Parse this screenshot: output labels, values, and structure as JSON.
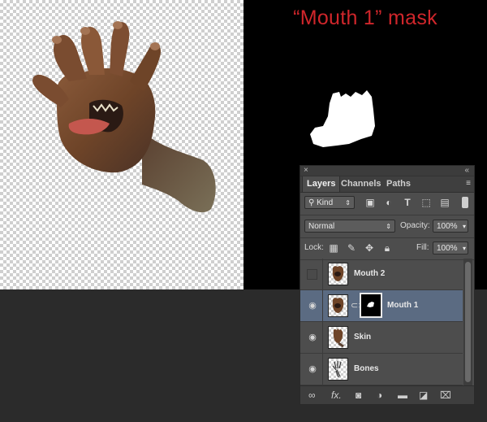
{
  "canvas": {
    "mask_label": "“Mouth 1” mask"
  },
  "panel": {
    "collapse_glyph": "«",
    "close_glyph": "×",
    "menu_glyph": "≡",
    "tabs": [
      {
        "label": "Layers",
        "active": true
      },
      {
        "label": "Channels",
        "active": false
      },
      {
        "label": "Paths",
        "active": false
      }
    ],
    "filter": {
      "kind_label": "Kind"
    },
    "blend_mode": "Normal",
    "opacity_label": "Opacity:",
    "opacity_value": "100%",
    "lock_label": "Lock:",
    "fill_label": "Fill:",
    "fill_value": "100%",
    "layers": [
      {
        "name": "Mouth 2",
        "visible": false,
        "has_mask": false,
        "selected": false
      },
      {
        "name": "Mouth 1",
        "visible": true,
        "has_mask": true,
        "selected": true
      },
      {
        "name": "Skin",
        "visible": true,
        "has_mask": false,
        "selected": false
      },
      {
        "name": "Bones",
        "visible": true,
        "has_mask": false,
        "selected": false
      }
    ],
    "footer_icons": [
      "link-icon",
      "fx-icon",
      "mask-icon",
      "adjustment-icon",
      "folder-icon",
      "new-layer-icon",
      "trash-icon"
    ]
  },
  "colors": {
    "mask_label": "#d0262b",
    "selected_row": "#5b6b82",
    "panel_bg": "#4d4d4d"
  }
}
